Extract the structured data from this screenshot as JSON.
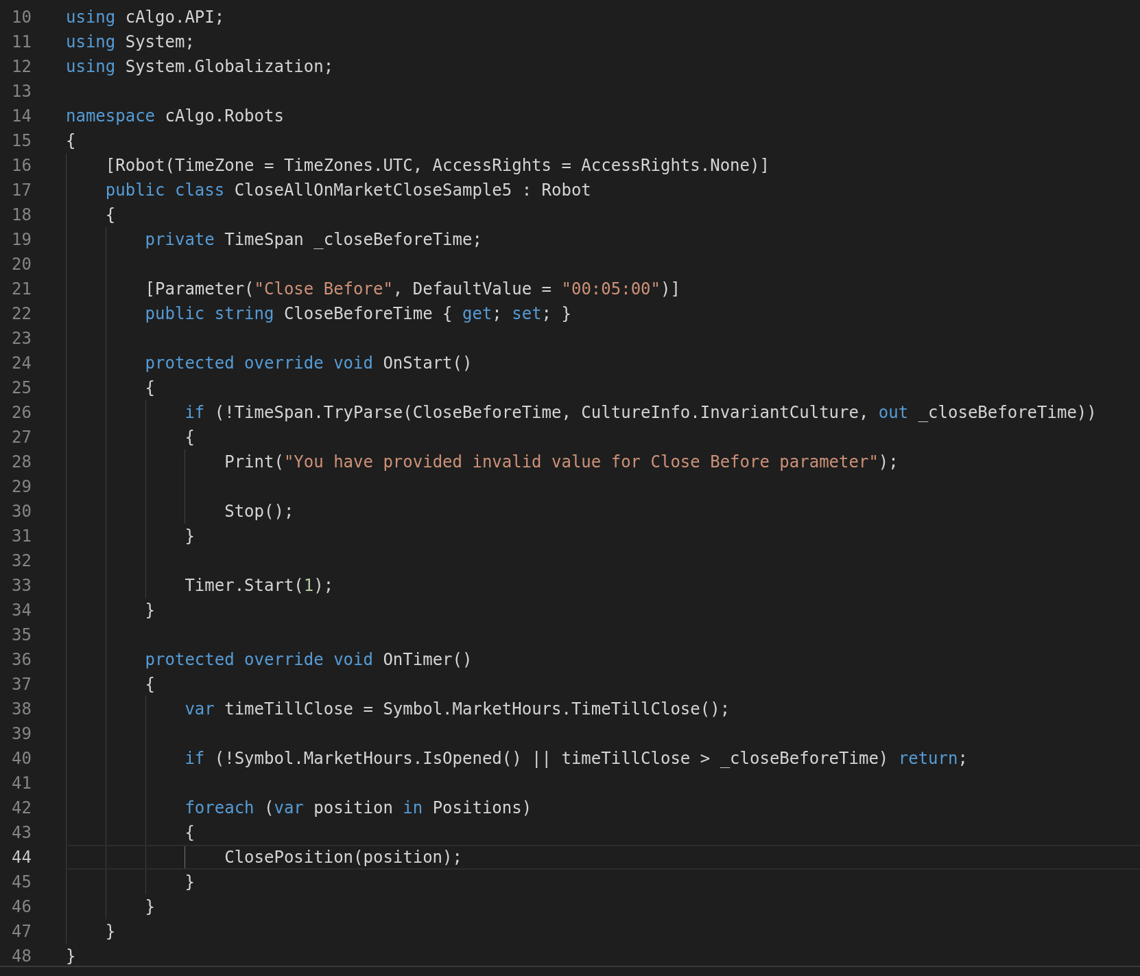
{
  "lines": [
    {
      "number": "10",
      "active": false,
      "tokens": [
        {
          "kind": "keyword",
          "text": "using"
        },
        {
          "kind": "plain",
          "text": " cAlgo.API;"
        }
      ]
    },
    {
      "number": "11",
      "active": false,
      "tokens": [
        {
          "kind": "keyword",
          "text": "using"
        },
        {
          "kind": "plain",
          "text": " System;"
        }
      ]
    },
    {
      "number": "12",
      "active": false,
      "tokens": [
        {
          "kind": "keyword",
          "text": "using"
        },
        {
          "kind": "plain",
          "text": " System.Globalization;"
        }
      ]
    },
    {
      "number": "13",
      "active": false
    },
    {
      "number": "14",
      "active": false,
      "tokens": [
        {
          "kind": "keyword",
          "text": "namespace"
        },
        {
          "kind": "plain",
          "text": " cAlgo.Robots"
        }
      ]
    },
    {
      "number": "15",
      "active": false,
      "tokens": [
        {
          "kind": "plain",
          "text": "{"
        }
      ]
    },
    {
      "number": "16",
      "active": false,
      "tokens": [
        {
          "kind": "plain",
          "text": "    [Robot(TimeZone = TimeZones.UTC, AccessRights = AccessRights.None)]"
        }
      ]
    },
    {
      "number": "17",
      "active": false,
      "tokens": [
        {
          "kind": "keyword",
          "text": "    public class"
        },
        {
          "kind": "plain",
          "text": " CloseAllOnMarketCloseSample5 : Robot"
        }
      ]
    },
    {
      "number": "18",
      "active": false,
      "tokens": [
        {
          "kind": "plain",
          "text": "    {"
        }
      ]
    },
    {
      "number": "19",
      "active": false,
      "tokens": [
        {
          "kind": "keyword",
          "text": "        private"
        },
        {
          "kind": "plain",
          "text": " TimeSpan _closeBeforeTime;"
        }
      ]
    },
    {
      "number": "20",
      "active": false
    },
    {
      "number": "21",
      "active": false,
      "tokens": [
        {
          "kind": "plain",
          "text": "        [Parameter("
        },
        {
          "kind": "string",
          "text": "\"Close Before\""
        },
        {
          "kind": "plain",
          "text": ", DefaultValue = "
        },
        {
          "kind": "string",
          "text": "\"00:05:00\""
        },
        {
          "kind": "plain",
          "text": ")]"
        }
      ]
    },
    {
      "number": "22",
      "active": false,
      "tokens": [
        {
          "kind": "keyword",
          "text": "        public string"
        },
        {
          "kind": "plain",
          "text": " CloseBeforeTime { "
        },
        {
          "kind": "keyword",
          "text": "get"
        },
        {
          "kind": "plain",
          "text": "; "
        },
        {
          "kind": "keyword",
          "text": "set"
        },
        {
          "kind": "plain",
          "text": "; }"
        }
      ]
    },
    {
      "number": "23",
      "active": false
    },
    {
      "number": "24",
      "active": false,
      "tokens": [
        {
          "kind": "keyword",
          "text": "        protected override void"
        },
        {
          "kind": "plain",
          "text": " OnStart()"
        }
      ]
    },
    {
      "number": "25",
      "active": false,
      "tokens": [
        {
          "kind": "plain",
          "text": "        {"
        }
      ]
    },
    {
      "number": "26",
      "active": false,
      "tokens": [
        {
          "kind": "keyword",
          "text": "            if"
        },
        {
          "kind": "plain",
          "text": " (!TimeSpan.TryParse(CloseBeforeTime, CultureInfo.InvariantCulture, "
        },
        {
          "kind": "keyword",
          "text": "out"
        },
        {
          "kind": "plain",
          "text": " _closeBeforeTime))"
        }
      ]
    },
    {
      "number": "27",
      "active": false,
      "tokens": [
        {
          "kind": "plain",
          "text": "            {"
        }
      ]
    },
    {
      "number": "28",
      "active": false,
      "tokens": [
        {
          "kind": "plain",
          "text": "                Print("
        },
        {
          "kind": "string",
          "text": "\"You have provided invalid value for Close Before parameter\""
        },
        {
          "kind": "plain",
          "text": ");"
        }
      ]
    },
    {
      "number": "29",
      "active": false
    },
    {
      "number": "30",
      "active": false,
      "tokens": [
        {
          "kind": "plain",
          "text": "                Stop();"
        }
      ]
    },
    {
      "number": "31",
      "active": false,
      "tokens": [
        {
          "kind": "plain",
          "text": "            }"
        }
      ]
    },
    {
      "number": "32",
      "active": false
    },
    {
      "number": "33",
      "active": false,
      "tokens": [
        {
          "kind": "plain",
          "text": "            Timer.Start("
        },
        {
          "kind": "number",
          "text": "1"
        },
        {
          "kind": "plain",
          "text": ");"
        }
      ]
    },
    {
      "number": "34",
      "active": false,
      "tokens": [
        {
          "kind": "plain",
          "text": "        }"
        }
      ]
    },
    {
      "number": "35",
      "active": false
    },
    {
      "number": "36",
      "active": false,
      "tokens": [
        {
          "kind": "keyword",
          "text": "        protected override void"
        },
        {
          "kind": "plain",
          "text": " OnTimer()"
        }
      ]
    },
    {
      "number": "37",
      "active": false,
      "tokens": [
        {
          "kind": "plain",
          "text": "        {"
        }
      ]
    },
    {
      "number": "38",
      "active": false,
      "tokens": [
        {
          "kind": "keyword",
          "text": "            var"
        },
        {
          "kind": "plain",
          "text": " timeTillClose = Symbol.MarketHours.TimeTillClose();"
        }
      ]
    },
    {
      "number": "39",
      "active": false
    },
    {
      "number": "40",
      "active": false,
      "tokens": [
        {
          "kind": "keyword",
          "text": "            if"
        },
        {
          "kind": "plain",
          "text": " (!Symbol.MarketHours.IsOpened() || timeTillClose > _closeBeforeTime) "
        },
        {
          "kind": "keyword",
          "text": "return"
        },
        {
          "kind": "plain",
          "text": ";"
        }
      ]
    },
    {
      "number": "41",
      "active": false
    },
    {
      "number": "42",
      "active": false,
      "tokens": [
        {
          "kind": "keyword",
          "text": "            foreach"
        },
        {
          "kind": "plain",
          "text": " ("
        },
        {
          "kind": "keyword",
          "text": "var"
        },
        {
          "kind": "plain",
          "text": " position "
        },
        {
          "kind": "keyword",
          "text": "in"
        },
        {
          "kind": "plain",
          "text": " Positions)"
        }
      ]
    },
    {
      "number": "43",
      "active": false,
      "tokens": [
        {
          "kind": "plain",
          "text": "            {"
        }
      ]
    },
    {
      "number": "44",
      "active": true,
      "tokens": [
        {
          "kind": "plain",
          "text": "                ClosePosition(position);"
        }
      ]
    },
    {
      "number": "45",
      "active": false,
      "tokens": [
        {
          "kind": "plain",
          "text": "            }"
        }
      ]
    },
    {
      "number": "46",
      "active": false,
      "tokens": [
        {
          "kind": "plain",
          "text": "        }"
        }
      ]
    },
    {
      "number": "47",
      "active": false,
      "tokens": [
        {
          "kind": "plain",
          "text": "    }"
        }
      ]
    },
    {
      "number": "48",
      "active": false,
      "tokens": [
        {
          "kind": "plain",
          "text": "}"
        }
      ]
    }
  ]
}
